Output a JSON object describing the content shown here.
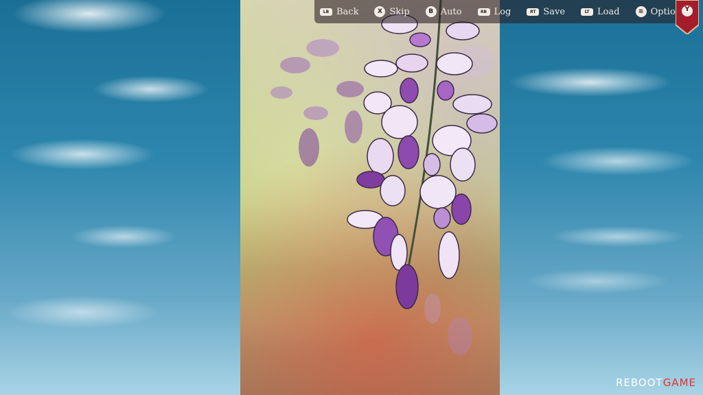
{
  "menu": {
    "items": [
      {
        "key": "back",
        "glyph": "LB",
        "glyph_shape": "rect",
        "label": "Back"
      },
      {
        "key": "skip",
        "glyph": "X",
        "glyph_shape": "circle",
        "label": "Skip"
      },
      {
        "key": "auto",
        "glyph": "B",
        "glyph_shape": "circle",
        "label": "Auto"
      },
      {
        "key": "log",
        "glyph": "RB",
        "glyph_shape": "rect",
        "label": "Log"
      },
      {
        "key": "save",
        "glyph": "RT",
        "glyph_shape": "rect",
        "label": "Save"
      },
      {
        "key": "load",
        "glyph": "LT",
        "glyph_shape": "rect",
        "label": "Load"
      },
      {
        "key": "options",
        "glyph": "≡",
        "glyph_shape": "circle",
        "label": "Options"
      }
    ],
    "hide_button": "Y"
  },
  "watermark": {
    "part1": "REBOOT",
    "part2": "GAME"
  },
  "colors": {
    "ribbon": "#a51c2b",
    "ribbon_border": "#d8c3a2",
    "watermark_accent": "#e8312c"
  },
  "scene": {
    "illustration": "wisteria-flowers"
  }
}
